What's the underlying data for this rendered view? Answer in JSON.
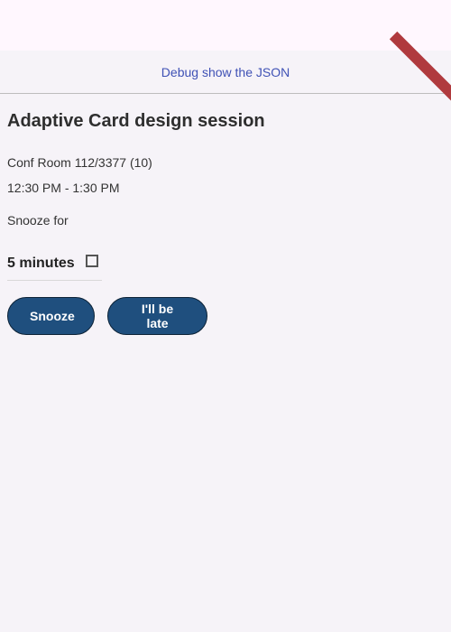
{
  "debug": {
    "link_label": "Debug show the JSON",
    "ribbon_color": "#b03a3e"
  },
  "card": {
    "title": "Adaptive Card design session",
    "location": "Conf Room 112/3377 (10)",
    "time": "12:30 PM - 1:30 PM",
    "snooze_label": "Snooze for",
    "snooze_select": {
      "selected": "5 minutes",
      "icon": "dropdown-checkbox-icon"
    },
    "actions": [
      {
        "label": "Snooze"
      },
      {
        "label": "I'll be late"
      }
    ],
    "accent_color": "#1f4f7e"
  }
}
